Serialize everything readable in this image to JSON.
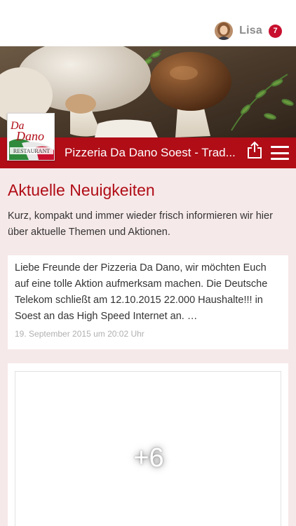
{
  "user": {
    "name": "Lisa",
    "notification_count": "7"
  },
  "header": {
    "title": "Pizzeria Da Dano Soest - Trad...",
    "logo": {
      "text_top": "Da Dano",
      "text_bottom": "RESTAURANT"
    }
  },
  "content": {
    "heading": "Aktuelle Neuigkeiten",
    "intro": "Kurz, kompakt und immer wieder frisch informieren wir hier über aktuelle Themen und Aktionen.",
    "news": [
      {
        "text": "Liebe Freunde der Pizzeria Da Dano, wir möchten Euch auf eine tolle Aktion aufmerksam machen. Die Deutsche Telekom schließt am 12.10.2015 22.000 Haushalte!!! in Soest an das High Speed Internet an. …",
        "date": "19. September 2015 um 20:02 Uhr"
      }
    ],
    "gallery": {
      "more_label": "+6"
    }
  },
  "colors": {
    "brand_red": "#b00d17",
    "badge_red": "#c8102e",
    "background": "#f6e9e9"
  },
  "icons": {
    "share": "share-icon",
    "menu": "hamburger-menu-icon"
  }
}
